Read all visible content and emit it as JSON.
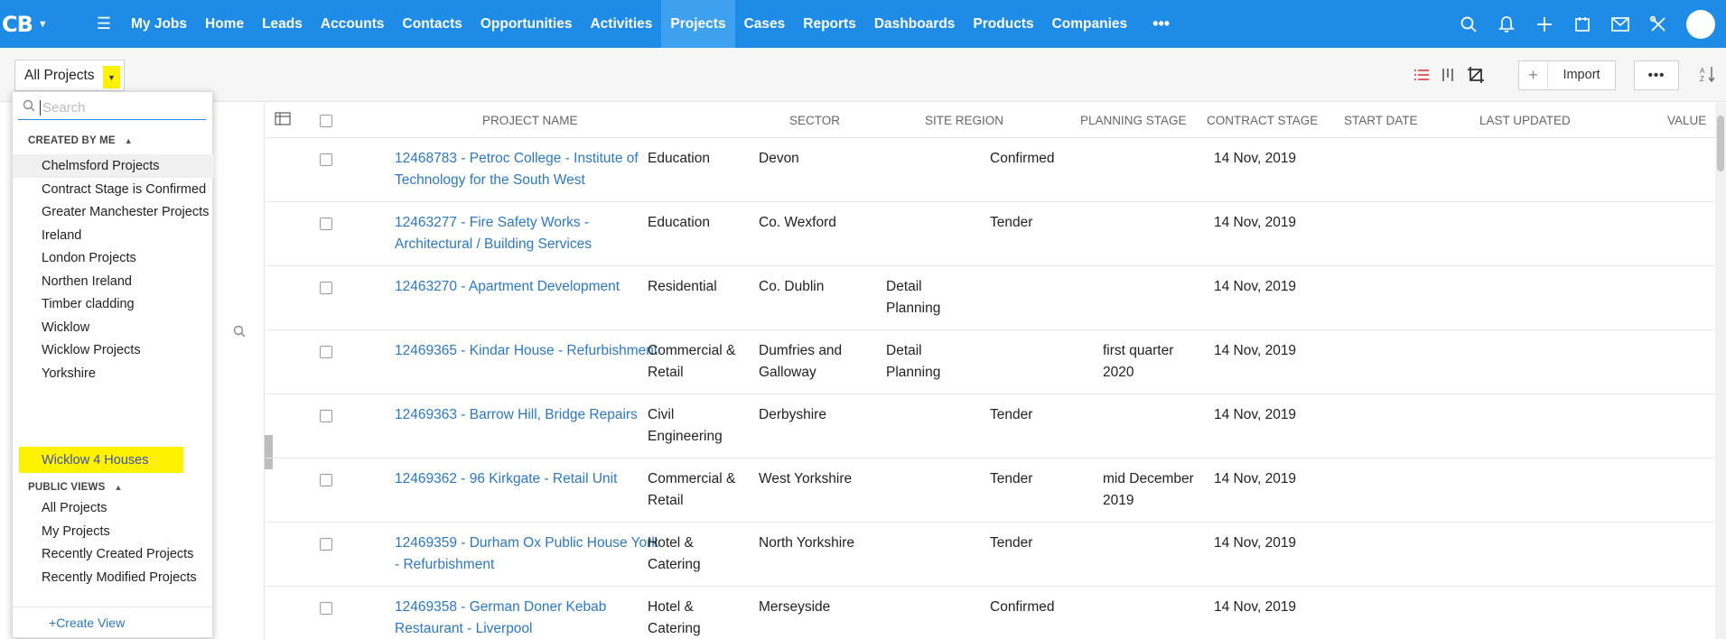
{
  "app": {
    "logo": "CB"
  },
  "nav": {
    "items": [
      "My Jobs",
      "Home",
      "Leads",
      "Accounts",
      "Contacts",
      "Opportunities",
      "Activities",
      "Projects",
      "Cases",
      "Reports",
      "Dashboards",
      "Products",
      "Companies"
    ],
    "active": "Projects",
    "more": "•••"
  },
  "toolbar": {
    "view_label": "All Projects",
    "import_label": "Import",
    "more_label": "•••"
  },
  "dropdown": {
    "search_placeholder": "Search",
    "created_by_me_header": "CREATED BY ME",
    "created_by_me": [
      "Chelmsford Projects",
      "Contract Stage is Confirmed",
      "Greater Manchester Projects",
      "Ireland",
      "London Projects",
      "Northen Ireland",
      "Timber cladding",
      "Wicklow",
      "Wicklow Projects",
      "Yorkshire",
      "Wicklow 4 Houses"
    ],
    "public_views_header": "PUBLIC VIEWS",
    "public_views": [
      "All Projects",
      "My Projects",
      "Recently Created Projects",
      "Recently Modified Projects"
    ],
    "create_view": "Create View"
  },
  "table": {
    "columns": {
      "name": "PROJECT NAME",
      "sector": "SECTOR",
      "region": "SITE REGION",
      "planning": "PLANNING STAGE",
      "contract": "CONTRACT STAGE",
      "start": "START DATE",
      "updated": "LAST UPDATED",
      "value": "VALUE"
    },
    "rows": [
      {
        "name_1": "12468783 - Petroc College - Institute of",
        "name_2": "Technology for the South West",
        "sector_1": "Education",
        "sector_2": "",
        "region_1": "Devon",
        "region_2": "",
        "planning_1": "",
        "planning_2": "",
        "contract": "Confirmed",
        "start_1": "",
        "start_2": "",
        "updated": "14 Nov, 2019"
      },
      {
        "name_1": "12463277 - Fire Safety Works -",
        "name_2": "Architectural / Building Services",
        "sector_1": "Education",
        "sector_2": "",
        "region_1": "Co. Wexford",
        "region_2": "",
        "planning_1": "",
        "planning_2": "",
        "contract": "Tender",
        "start_1": "",
        "start_2": "",
        "updated": "14 Nov, 2019"
      },
      {
        "name_1": "12463270 - Apartment Development",
        "name_2": "",
        "sector_1": "Residential",
        "sector_2": "",
        "region_1": "Co. Dublin",
        "region_2": "",
        "planning_1": "Detail",
        "planning_2": "Planning",
        "contract": "",
        "start_1": "",
        "start_2": "",
        "updated": "14 Nov, 2019"
      },
      {
        "name_1": "12469365 - Kindar House - Refurbishment",
        "name_2": "",
        "sector_1": "Commercial &",
        "sector_2": "Retail",
        "region_1": "Dumfries and",
        "region_2": "Galloway",
        "planning_1": "Detail",
        "planning_2": "Planning",
        "contract": "",
        "start_1": "first quarter",
        "start_2": "2020",
        "updated": "14 Nov, 2019"
      },
      {
        "name_1": "12469363 - Barrow Hill, Bridge Repairs",
        "name_2": "",
        "sector_1": "Civil",
        "sector_2": "Engineering",
        "region_1": "Derbyshire",
        "region_2": "",
        "planning_1": "",
        "planning_2": "",
        "contract": "Tender",
        "start_1": "",
        "start_2": "",
        "updated": "14 Nov, 2019"
      },
      {
        "name_1": "12469362 - 96 Kirkgate - Retail Unit",
        "name_2": "",
        "sector_1": "Commercial &",
        "sector_2": "Retail",
        "region_1": "West Yorkshire",
        "region_2": "",
        "planning_1": "",
        "planning_2": "",
        "contract": "Tender",
        "start_1": "mid December",
        "start_2": "2019",
        "updated": "14 Nov, 2019"
      },
      {
        "name_1": "12469359 - Durham Ox Public House York",
        "name_2": "- Refurbishment",
        "sector_1": "Hotel &",
        "sector_2": "Catering",
        "region_1": "North Yorkshire",
        "region_2": "",
        "planning_1": "",
        "planning_2": "",
        "contract": "Tender",
        "start_1": "",
        "start_2": "",
        "updated": "14 Nov, 2019"
      },
      {
        "name_1": "12469358 - German Doner Kebab",
        "name_2": "Restaurant - Liverpool",
        "sector_1": "Hotel &",
        "sector_2": "Catering",
        "region_1": "Merseyside",
        "region_2": "",
        "planning_1": "",
        "planning_2": "",
        "contract": "Confirmed",
        "start_1": "",
        "start_2": "",
        "updated": "14 Nov, 2019"
      }
    ]
  },
  "colors": {
    "nav_bg": "#1e8ce6",
    "nav_active": "#3ea1f0",
    "highlight": "#fff200",
    "link": "#2a78c7"
  }
}
